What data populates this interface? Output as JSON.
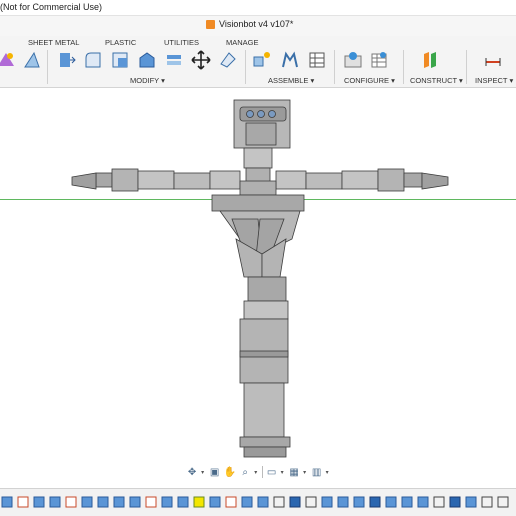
{
  "app": {
    "title": "(Not for Commercial Use)",
    "document_tab": "Visionbot v4 v107*"
  },
  "ribbon": {
    "workspace_tabs": [
      "SHEET METAL",
      "PLASTIC",
      "UTILITIES",
      "MANAGE"
    ],
    "groups": [
      "MODIFY ▾",
      "ASSEMBLE ▾",
      "CONFIGURE ▾",
      "CONSTRUCT ▾",
      "INSPECT ▾"
    ]
  },
  "viewport": {
    "ground_line_color": "#5fb85f",
    "model_color": "#8a8a8a"
  },
  "nav_toolbar": {
    "icons": [
      "orbit-icon",
      "look-at-icon",
      "pan-icon",
      "zoom-icon",
      "display-settings-icon",
      "grid-settings-icon",
      "viewports-icon"
    ]
  },
  "timeline": {
    "highlight_color": "#f3e600"
  }
}
